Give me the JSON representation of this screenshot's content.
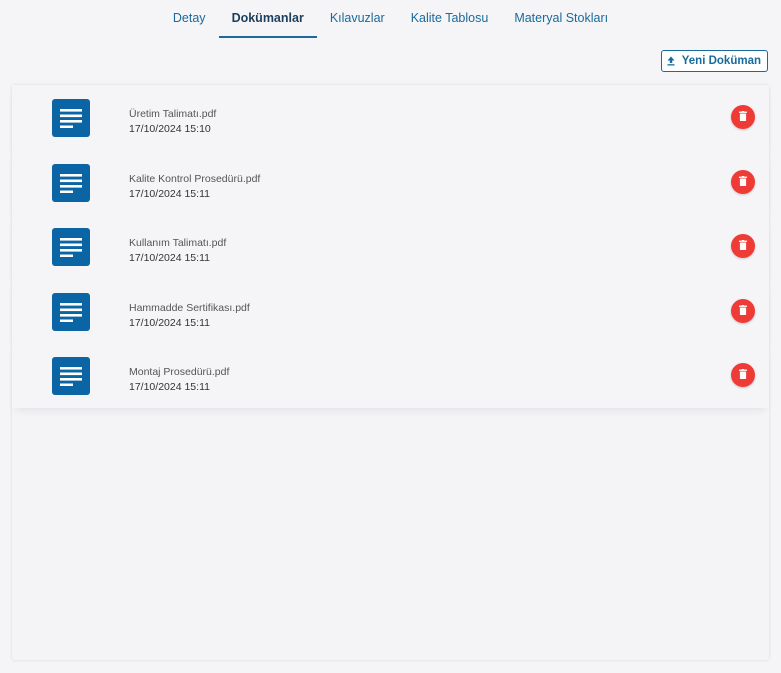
{
  "tabs": [
    {
      "label": "Detay"
    },
    {
      "label": "Dokümanlar"
    },
    {
      "label": "Kılavuzlar"
    },
    {
      "label": "Kalite Tablosu"
    },
    {
      "label": "Materyal Stokları"
    }
  ],
  "active_tab": "Dokümanlar",
  "toolbar": {
    "new_document_label": "Yeni Doküman",
    "upload_icon": "upload-icon"
  },
  "documents": [
    {
      "name": "Üretim Talimatı.pdf",
      "date": "17/10/2024 15:10"
    },
    {
      "name": "Kalite Kontrol Prosedürü.pdf",
      "date": "17/10/2024 15:11"
    },
    {
      "name": "Kullanım Talimatı.pdf",
      "date": "17/10/2024 15:11"
    },
    {
      "name": "Hammadde Sertifikası.pdf",
      "date": "17/10/2024 15:11"
    },
    {
      "name": "Montaj Prosedürü.pdf",
      "date": "17/10/2024 15:11"
    }
  ],
  "colors": {
    "accent": "#1a6a9a",
    "doc_icon_bg": "#0b64a4",
    "delete_bg": "#ef3b36"
  },
  "icons": {
    "document": "document-icon",
    "delete": "trash-icon"
  }
}
